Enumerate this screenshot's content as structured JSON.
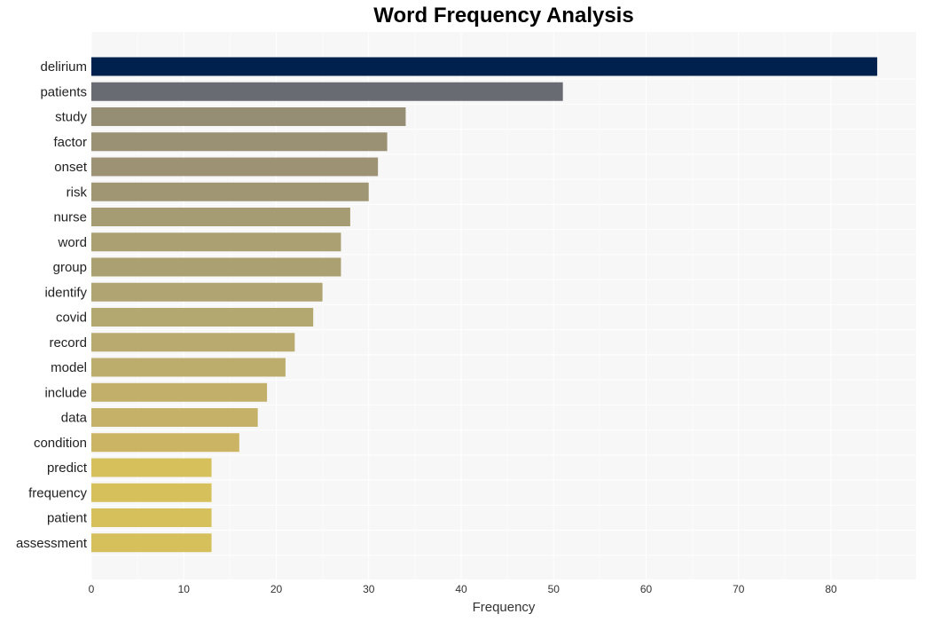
{
  "chart_data": {
    "type": "bar",
    "orientation": "horizontal",
    "title": "Word Frequency Analysis",
    "xlabel": "Frequency",
    "ylabel": "",
    "xlim": [
      0,
      89
    ],
    "xticks": [
      0,
      10,
      20,
      30,
      40,
      50,
      60,
      70,
      80
    ],
    "grid": true,
    "categories": [
      "delirium",
      "patients",
      "study",
      "factor",
      "onset",
      "risk",
      "nurse",
      "word",
      "group",
      "identify",
      "covid",
      "record",
      "model",
      "include",
      "data",
      "condition",
      "predict",
      "frequency",
      "patient",
      "assessment"
    ],
    "values": [
      85,
      51,
      34,
      32,
      31,
      30,
      28,
      27,
      27,
      25,
      24,
      22,
      21,
      19,
      18,
      16,
      13,
      13,
      13,
      13
    ],
    "colors": [
      "#00214d",
      "#696b73",
      "#958d74",
      "#9a9073",
      "#9d9374",
      "#a09674",
      "#a69c73",
      "#aaa072",
      "#aaa072",
      "#afa472",
      "#b4a871",
      "#b9aa6f",
      "#bdad6d",
      "#c2b06a",
      "#c5b268",
      "#cbb564",
      "#d6c05c",
      "#d6c05c",
      "#d6c05c",
      "#d6c05c"
    ]
  }
}
